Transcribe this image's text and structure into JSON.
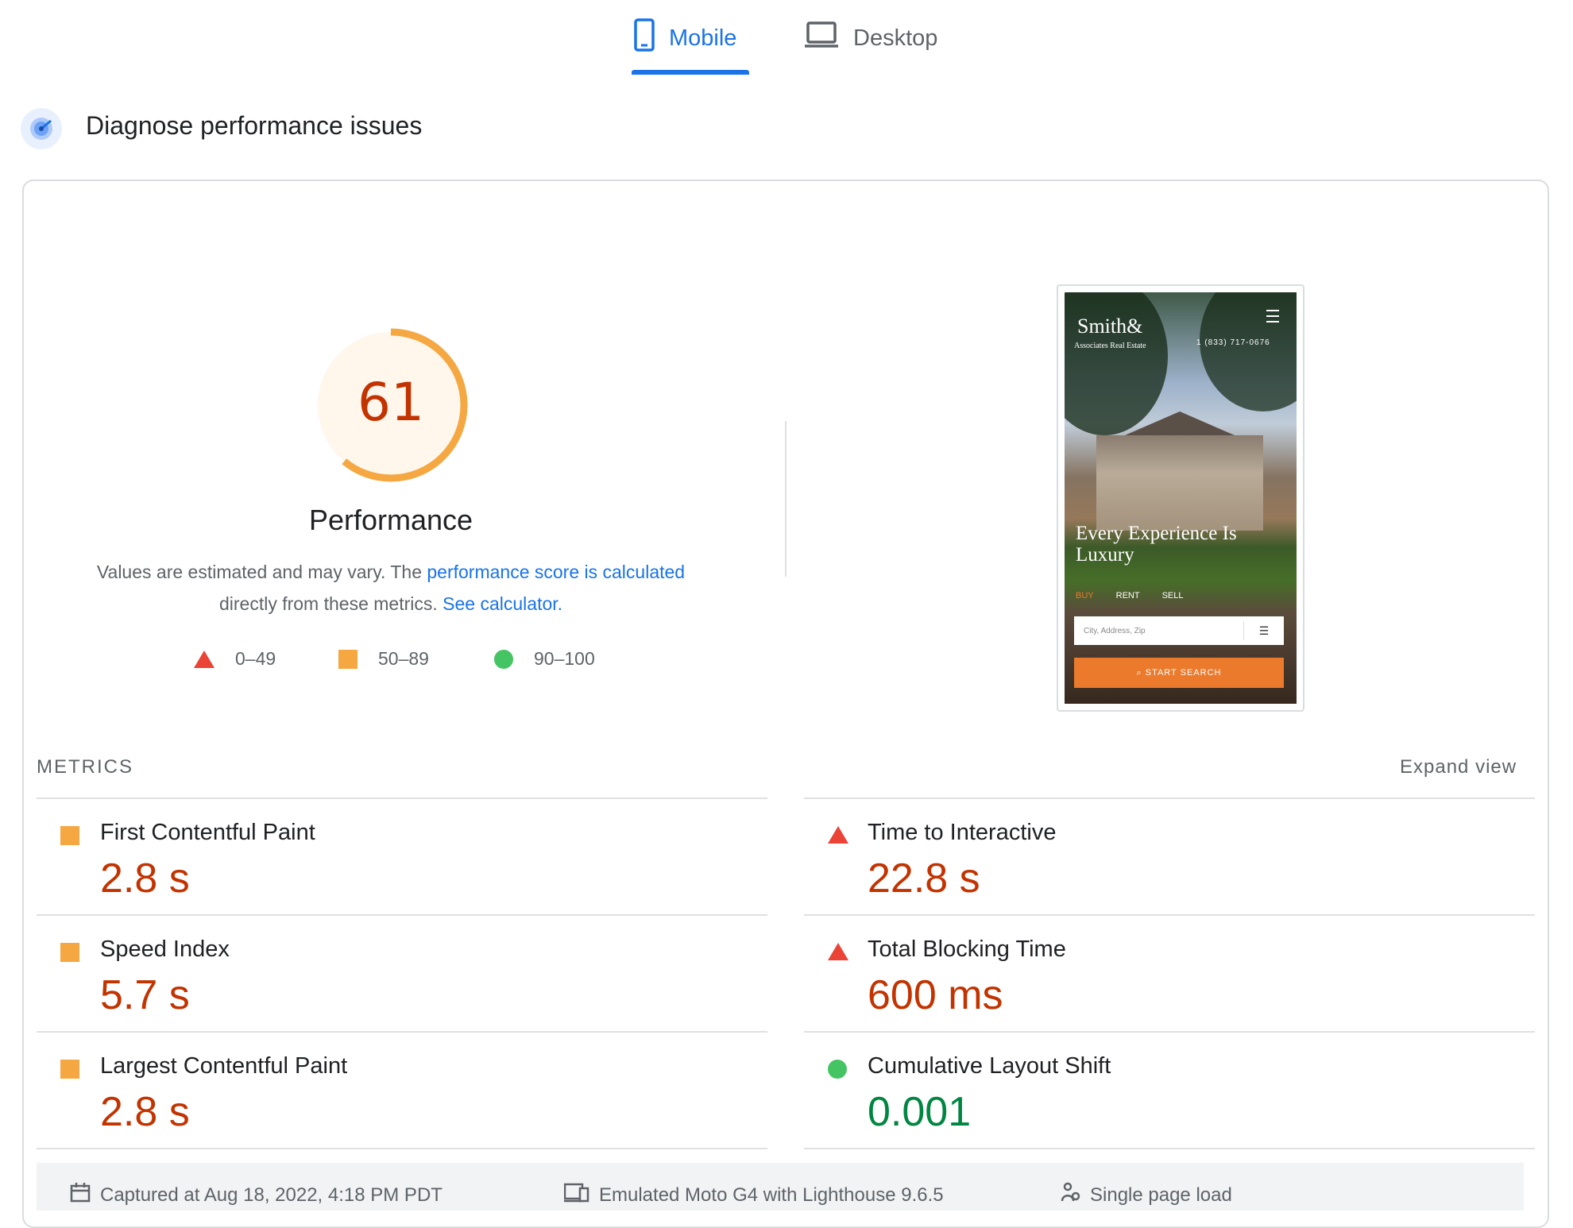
{
  "tabs": {
    "mobile": "Mobile",
    "desktop": "Desktop"
  },
  "header": {
    "title": "Diagnose performance issues"
  },
  "score": {
    "value": "61",
    "fraction": 0.61,
    "label": "Performance",
    "desc_prefix": "Values are estimated and may vary. The ",
    "desc_link": "performance score is calculated",
    "desc_mid": " directly from these metrics. ",
    "calc_link": "See calculator."
  },
  "legend": {
    "fail": "0–49",
    "average": "50–89",
    "pass": "90–100"
  },
  "screenshot": {
    "logo": "Smith&",
    "logo_sub": "Associates Real Estate",
    "phone": "1 (833) 717-0676",
    "headline": "Every Experience Is Luxury",
    "nav": [
      "BUY",
      "RENT",
      "SELL"
    ],
    "search_placeholder": "City, Address, Zip",
    "cta": "START SEARCH"
  },
  "metrics": {
    "label": "METRICS",
    "expand": "Expand view",
    "items": [
      {
        "name": "First Contentful Paint",
        "value": "2.8 s",
        "status": "average"
      },
      {
        "name": "Time to Interactive",
        "value": "22.8 s",
        "status": "fail"
      },
      {
        "name": "Speed Index",
        "value": "5.7 s",
        "status": "average"
      },
      {
        "name": "Total Blocking Time",
        "value": "600 ms",
        "status": "fail"
      },
      {
        "name": "Largest Contentful Paint",
        "value": "2.8 s",
        "status": "average"
      },
      {
        "name": "Cumulative Layout Shift",
        "value": "0.001",
        "status": "pass"
      }
    ]
  },
  "footer": {
    "captured": "Captured at Aug 18, 2022, 4:18 PM PDT",
    "device": "Emulated Moto G4 with Lighthouse 9.6.5",
    "load": "Single page load"
  },
  "colors": {
    "accent": "#1a73e8",
    "average": "#f5a742",
    "fail": "#eb4335",
    "pass": "#45c463",
    "fail_text": "#c33300",
    "pass_text": "#018642"
  }
}
